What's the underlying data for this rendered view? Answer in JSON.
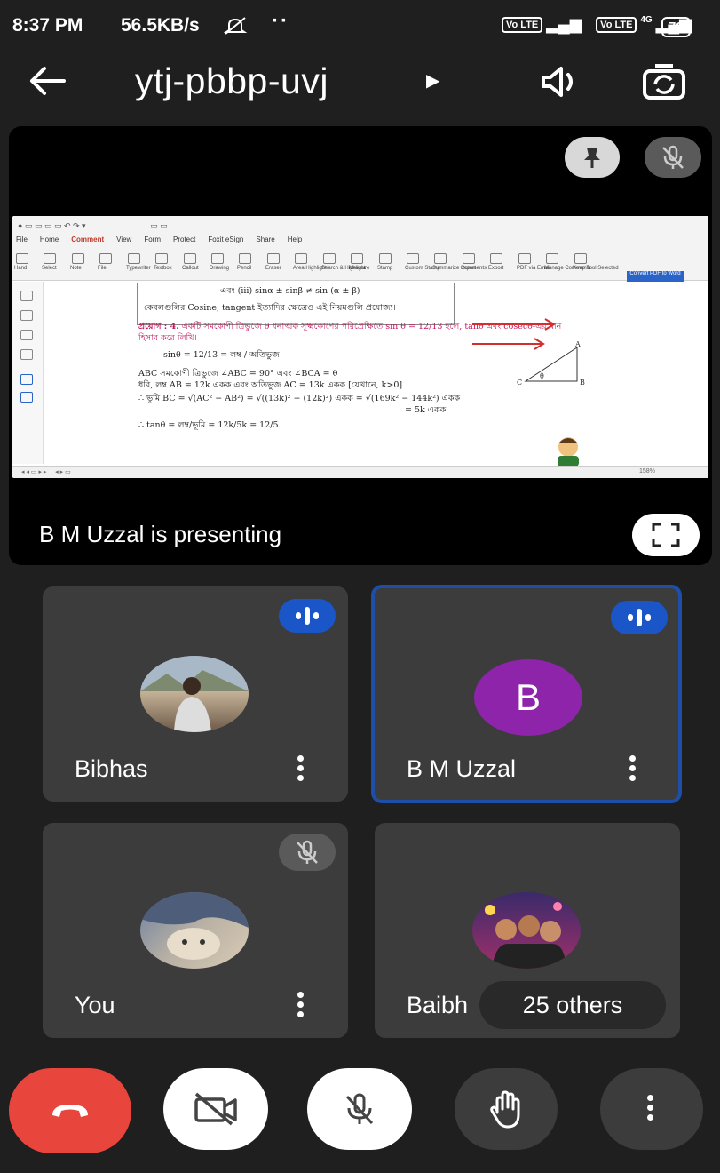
{
  "status_bar": {
    "time": "8:37 PM",
    "speed": "56.5KB/s",
    "dots": "··",
    "sim1": "Vo LTE",
    "sim2": "Vo LTE",
    "net_type": "4G",
    "battery": "79"
  },
  "top_bar": {
    "meeting_code": "ytj-pbbp-uvj"
  },
  "stage": {
    "presenting_label": "B M Uzzal is presenting",
    "slide": {
      "line1": "এবং   (iii) sinα ± sinβ ≠ sin (α ± β)",
      "line2": "কেবলগুলির Cosine, tangent ইত্যাদির ক্ষেত্রেও এই নিয়মগুলি প্রযোজ্য।",
      "example_heading": "প্রয়োগ : 4.",
      "example_text": "একটি সমকোণী ত্রিভুজে θ ধনাত্মক সূক্ষ্মকোণের পরিপ্রেক্ষিতে sin θ = 12/13 হলে, tanθ এবং cosecθ-এর মান হিসাব করে লিখি।",
      "eq1": "sinθ = 12/13 = লম্ব / অতিভুজ",
      "eq2": "ABC সমকোণী ত্রিভুজে ∠ABC = 90° এবং ∠BCA = θ",
      "eq3": "ধরি, লম্ব AB = 12k একক এবং অতিভুজ AC = 13k একক  [যেখানে, k>0]",
      "eq4": "∴ ভূমি BC = √(AC² − AB²) = √((13k)² − (12k)²) একক = √(169k² − 144k²) একক",
      "eq5": "= 5k একক",
      "eq6": "∴ tanθ = লম্ব/ভূমি = 12k/5k = 12/5",
      "triangle_labels": [
        "A",
        "C",
        "θ",
        "B"
      ],
      "toolbar_tabs": [
        "File",
        "Home",
        "Comment",
        "View",
        "Form",
        "Protect",
        "Foxit eSign",
        "Share",
        "Help"
      ],
      "active_tab": "Comment",
      "toolbar_items": [
        "Hand",
        "Select",
        "Note",
        "File",
        "Typewriter",
        "Textbox",
        "Callout",
        "Drawing",
        "Pencil",
        "Eraser",
        "Area Highlight",
        "Search & Highlight",
        "Measure",
        "Stamp",
        "Custom Stamp",
        "Summarize Comments",
        "Import",
        "Export",
        "PDF via Email",
        "Manage Comments",
        "Keep Tool Selected"
      ],
      "convert_label": "Convert PDF to Word",
      "zoom": "158%"
    }
  },
  "participants": [
    {
      "name": "Bibhas",
      "speaking": true
    },
    {
      "name": "B M Uzzal",
      "initial": "B",
      "speaking": true,
      "active": true
    },
    {
      "name": "You",
      "muted": true
    },
    {
      "name": "Baibh",
      "overlay": "25 others"
    }
  ],
  "colors": {
    "background": "#1f1f1f",
    "tile": "#3c3c3c",
    "speaking_blue": "#1a56c8",
    "active_border": "#1d4ea8",
    "avatar_purple": "#8e24aa",
    "end_call_red": "#e8453c"
  },
  "icons": [
    "back-arrow-icon",
    "caret-right-icon",
    "speaker-icon",
    "camera-switch-icon",
    "pin-icon",
    "mic-off-icon",
    "fullscreen-icon",
    "more-vert-icon",
    "end-call-icon",
    "camera-off-icon",
    "raise-hand-icon"
  ]
}
